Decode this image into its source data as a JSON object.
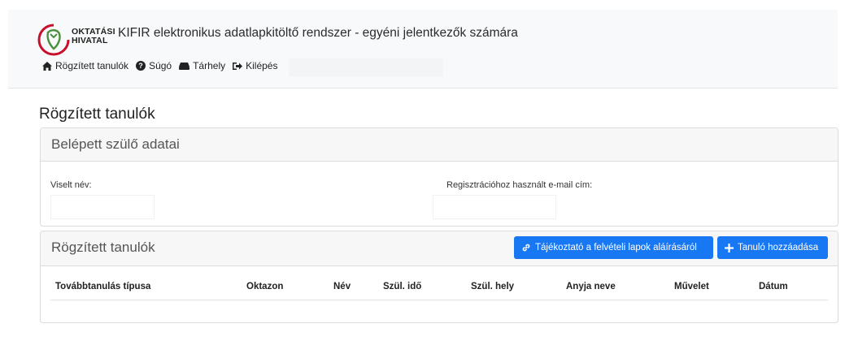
{
  "header": {
    "logo_text_line1": "OKTATÁSI",
    "logo_text_line2": "HIVATAL",
    "app_title": "KIFIR elektronikus adatlapkitöltő rendszer - egyéni jelentkezők számára",
    "nav": [
      {
        "label": "Rögzített tanulók",
        "icon": "home-icon"
      },
      {
        "label": "Súgó",
        "icon": "help-circle-icon"
      },
      {
        "label": "Tárhely",
        "icon": "hdd-icon"
      },
      {
        "label": "Kilépés",
        "icon": "sign-out-icon"
      }
    ]
  },
  "page_title": "Rögzített tanulók",
  "parent_card": {
    "title": "Belépett szülő adatai",
    "name_label": "Viselt név:",
    "email_label": "Regisztrációhoz használt e-mail cím:"
  },
  "students_card": {
    "title": "Rögzített tanulók",
    "info_button": "Tájékoztató a felvételi lapok aláírásáról",
    "add_button": "Tanuló hozzáadása",
    "columns": [
      "Továbbtanulás típusa",
      "Oktazon",
      "Név",
      "Szül. idő",
      "Szül. hely",
      "Anyja neve",
      "Művelet",
      "Dátum"
    ]
  },
  "colors": {
    "primary": "#1877f2",
    "logo_red": "#c8102e",
    "logo_green": "#4a8f3c"
  }
}
